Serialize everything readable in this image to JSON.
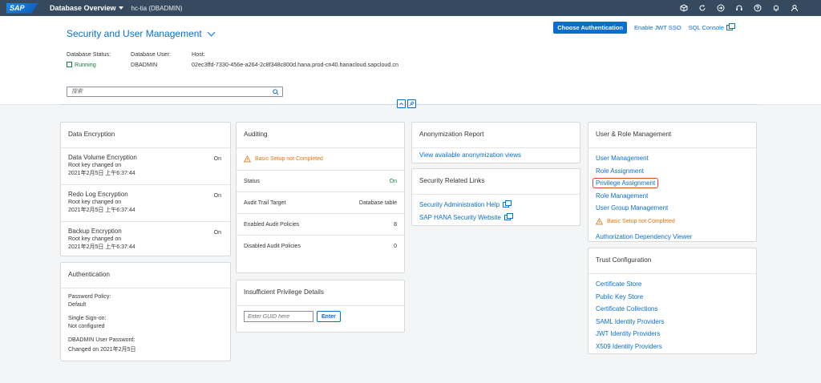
{
  "shell": {
    "logo": "SAP",
    "title": "Database Overview",
    "subtitle": "hc-tia (DBADMIN)",
    "icons": [
      "cube-icon",
      "refresh-icon",
      "navigation-icon",
      "headset-icon",
      "help-icon",
      "bell-icon",
      "user-icon"
    ]
  },
  "header": {
    "title": "Security and User Management",
    "actions": {
      "choose_auth": "Choose Authentication",
      "enable_jwt": "Enable JWT SSO",
      "sql_console": "SQL Console"
    },
    "status_label": "Database Status:",
    "status_value": "Running",
    "user_label": "Database User:",
    "user_value": "DBADMIN",
    "host_label": "Host:",
    "host_value": "02ec3ffd-7330-456e-a264-2c8f348c800d.hana.prod-cn40.hanacloud.sapcloud.cn",
    "search_placeholder": "搜索"
  },
  "encryption": {
    "title": "Data Encryption",
    "rows": [
      {
        "name": "Data Volume Encryption",
        "sub1": "Root key changed on",
        "sub2": "2021年2月5日 上午6:37:44",
        "state": "On"
      },
      {
        "name": "Redo Log Encryption",
        "sub1": "Root key changed on",
        "sub2": "2021年2月5日 上午6:37:44",
        "state": "On"
      },
      {
        "name": "Backup Encryption",
        "sub1": "Root key changed on",
        "sub2": "2021年2月5日 上午6:37:44",
        "state": "On"
      }
    ]
  },
  "authentication": {
    "title": "Authentication",
    "password_policy_label": "Password Policy:",
    "password_policy_value": "Default",
    "sso_label": "Single Sign-on:",
    "sso_value": "Not configured",
    "pwd_label": "DBADMIN User Password:",
    "pwd_value": "Changed on 2021年2月5日"
  },
  "auditing": {
    "title": "Auditing",
    "warning": "Basic Setup not Completed",
    "rows": [
      {
        "label": "Status",
        "value": "On"
      },
      {
        "label": "Audit Trail Target",
        "value": "Database table"
      },
      {
        "label": "Enabled Audit Policies",
        "value": "8"
      },
      {
        "label": "Disabled Audit Policies",
        "value": "0"
      }
    ]
  },
  "insufficient": {
    "title": "Insufficient Privilege Details",
    "placeholder": "Enter GUID here",
    "button": "Enter"
  },
  "anonymization": {
    "title": "Anonymization Report",
    "link": "View available anonymization views"
  },
  "security_links": {
    "title": "Security Related Links",
    "links": [
      "Security Administration Help",
      "SAP HANA Security Website"
    ]
  },
  "user_role": {
    "title": "User & Role Management",
    "links": [
      "User Management",
      "Role Assignment",
      "Privilege Assignment",
      "Role Management",
      "User Group Management"
    ],
    "warning": "Basic Setup not Completed",
    "viewer": "Authorization Dependency Viewer"
  },
  "trust": {
    "title": "Trust Configuration",
    "links": [
      "Certificate Store",
      "Public Key Store",
      "Certificate Collections",
      "SAML Identity Providers",
      "JWT Identity Providers",
      "X509 Identity Providers"
    ]
  },
  "colors": {
    "shell": "#354a5f",
    "brand": "#0a6ed1",
    "positive": "#107e3e",
    "warning": "#e9730c",
    "highlight": "#e04b2a"
  }
}
